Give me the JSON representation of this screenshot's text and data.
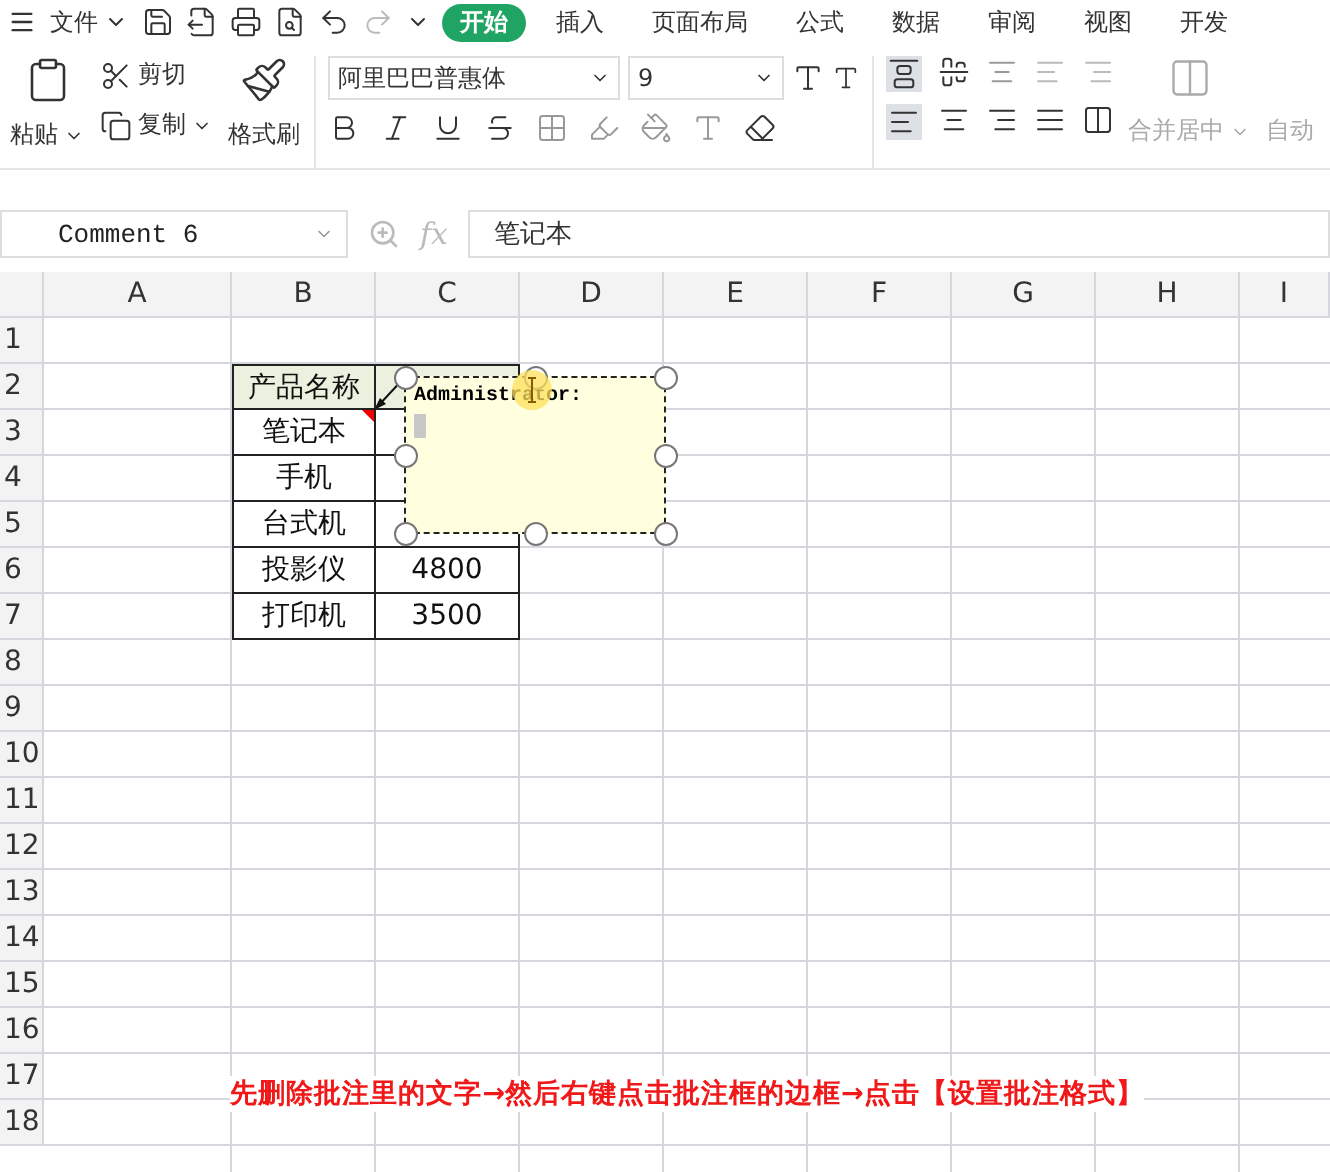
{
  "menu": {
    "file_label": "文件",
    "tabs": [
      {
        "label": "开始",
        "selected": true
      },
      {
        "label": "插入",
        "selected": false
      },
      {
        "label": "页面布局",
        "selected": false
      },
      {
        "label": "公式",
        "selected": false
      },
      {
        "label": "数据",
        "selected": false
      },
      {
        "label": "审阅",
        "selected": false
      },
      {
        "label": "视图",
        "selected": false
      },
      {
        "label": "开发",
        "selected": false
      }
    ]
  },
  "ribbon": {
    "paste": "粘贴",
    "cut": "剪切",
    "copy": "复制",
    "format_painter": "格式刷",
    "font_name": "阿里巴巴普惠体",
    "font_size": "9",
    "merge": "合并居中",
    "wrap": "自动"
  },
  "formula_bar": {
    "name_box": "Comment 6",
    "fx_label": "fx",
    "value": "笔记本"
  },
  "columns": [
    "A",
    "B",
    "C",
    "D",
    "E",
    "F",
    "G",
    "H",
    "I"
  ],
  "rows": [
    "1",
    "2",
    "3",
    "4",
    "5",
    "6",
    "7",
    "8",
    "9",
    "10",
    "11",
    "12",
    "13",
    "14",
    "15",
    "16",
    "17",
    "18"
  ],
  "table": {
    "rows": [
      {
        "kind": "header",
        "cells": [
          "产品名称"
        ]
      },
      {
        "kind": "data",
        "cells": [
          "笔记本"
        ],
        "has_comment": true
      },
      {
        "kind": "data",
        "cells": [
          "手机"
        ],
        "has_comment": false
      },
      {
        "kind": "data",
        "cells": [
          "台式机"
        ],
        "has_comment": false
      },
      {
        "kind": "data",
        "cells": [
          "投影仪",
          "4800"
        ],
        "has_comment": false
      },
      {
        "kind": "data",
        "cells": [
          "打印机",
          "3500"
        ],
        "has_comment": false
      }
    ]
  },
  "comment": {
    "author": "Administrator:"
  },
  "caption": "先删除批注里的文字→然后右键点击批注框的边框→点击【设置批注格式】"
}
